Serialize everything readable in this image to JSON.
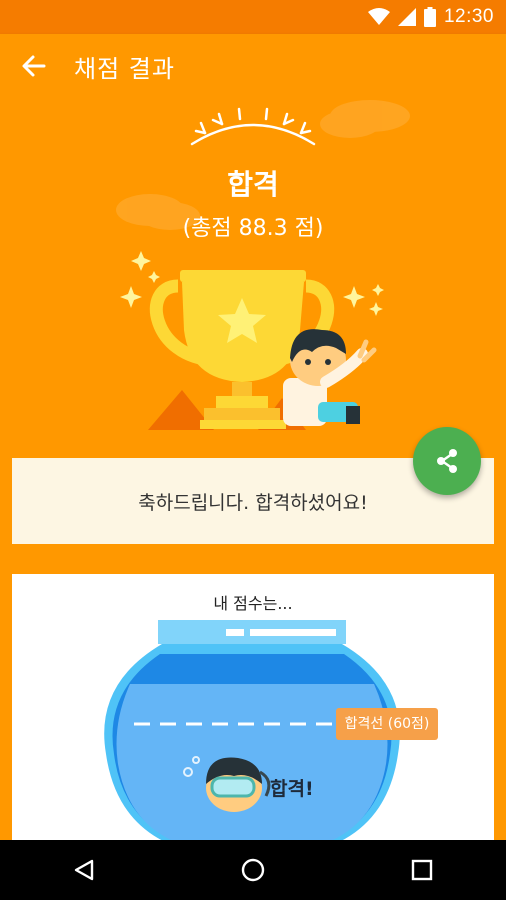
{
  "status_bar": {
    "time": "12:30"
  },
  "app_bar": {
    "title": "채점 결과"
  },
  "result": {
    "title": "합격",
    "score_text": "(총점 88.3 점)"
  },
  "message": {
    "text": "축하드립니다. 합격하셨어요!"
  },
  "score_section": {
    "heading": "내 점수는...",
    "pass_line_label": "합격선 (60점)",
    "status_label": "합격!"
  },
  "colors": {
    "primary": "#FF9800",
    "status_bar": "#F57C00",
    "fab": "#4CAF50",
    "card_bg": "#FDF6E3",
    "water": "#64B5F6"
  }
}
